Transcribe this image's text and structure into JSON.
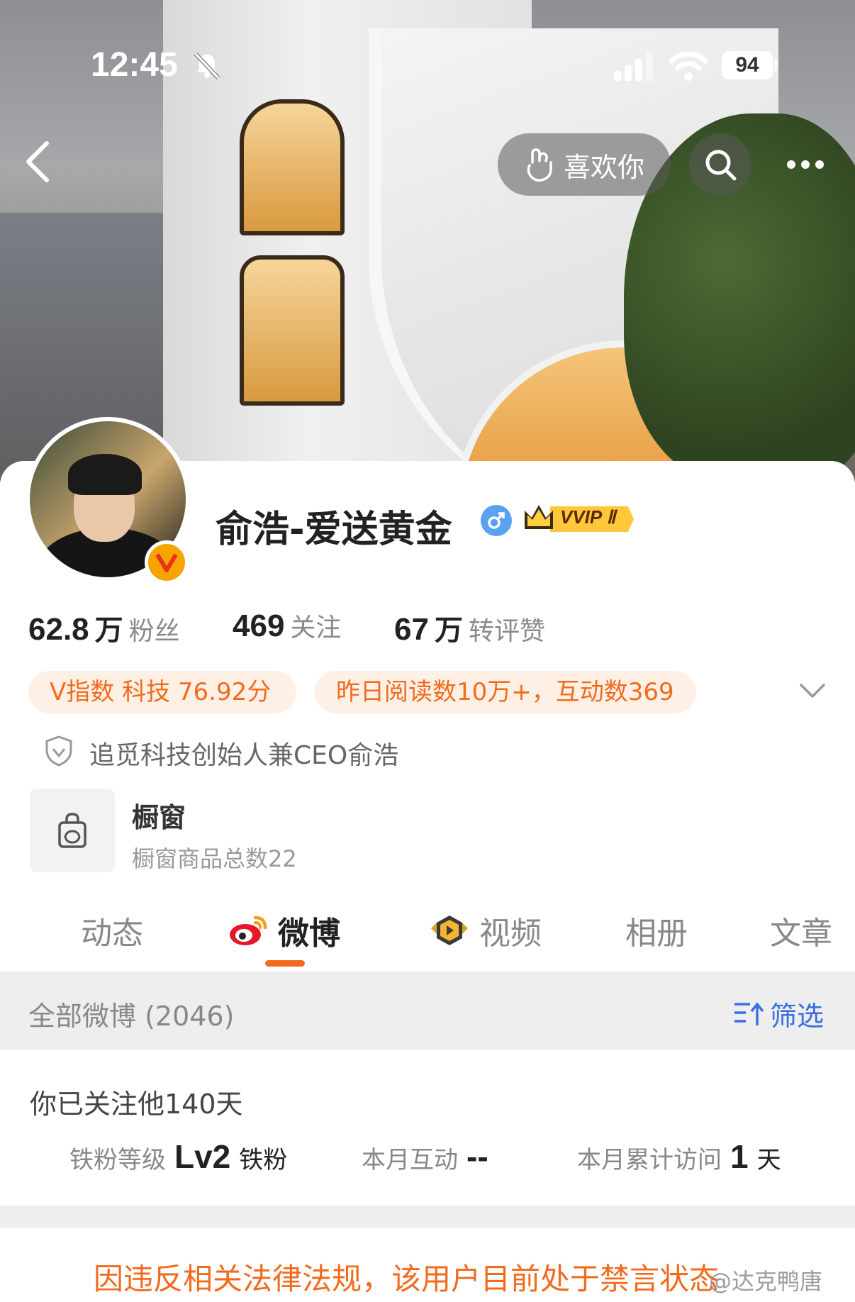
{
  "status_bar": {
    "time": "12:45",
    "battery": "94"
  },
  "nav": {
    "like_label": "喜欢你"
  },
  "profile": {
    "name": "俞浩-爱送黄金",
    "vvip": "VVIP Ⅱ",
    "stats": [
      {
        "num": "62.8",
        "unit": "万",
        "label": "粉丝"
      },
      {
        "num": "469",
        "unit": "",
        "label": "关注"
      },
      {
        "num": "67",
        "unit": "万",
        "label": "转评赞"
      }
    ],
    "tags": [
      "V指数 科技 76.92分",
      "昨日阅读数10万+，互动数369"
    ],
    "certification": "追觅科技创始人兼CEO俞浩",
    "shop": {
      "title": "橱窗",
      "subtitle": "橱窗商品总数22"
    }
  },
  "tabs": [
    {
      "label": "动态",
      "active": false
    },
    {
      "label": "微博",
      "active": true
    },
    {
      "label": "视频",
      "active": false
    },
    {
      "label": "相册",
      "active": false
    },
    {
      "label": "文章",
      "active": false
    }
  ],
  "filter": {
    "label": "全部微博 (2046)",
    "button": "筛选"
  },
  "fan_info": {
    "follow_days": "你已关注他140天",
    "level_label": "铁粉等级",
    "level_value": "Lv2",
    "level_suffix": "铁粉",
    "interaction_label": "本月互动",
    "interaction_value": "--",
    "visits_label": "本月累计访问",
    "visits_value": "1",
    "visits_suffix": "天"
  },
  "notice": "因违反相关法律法规，该用户目前处于禁言状态",
  "watermark": "@达克鸭唐",
  "colors": {
    "accent": "#f26b1d",
    "link": "#3a6fe0",
    "tag_bg": "#fff0e6"
  }
}
